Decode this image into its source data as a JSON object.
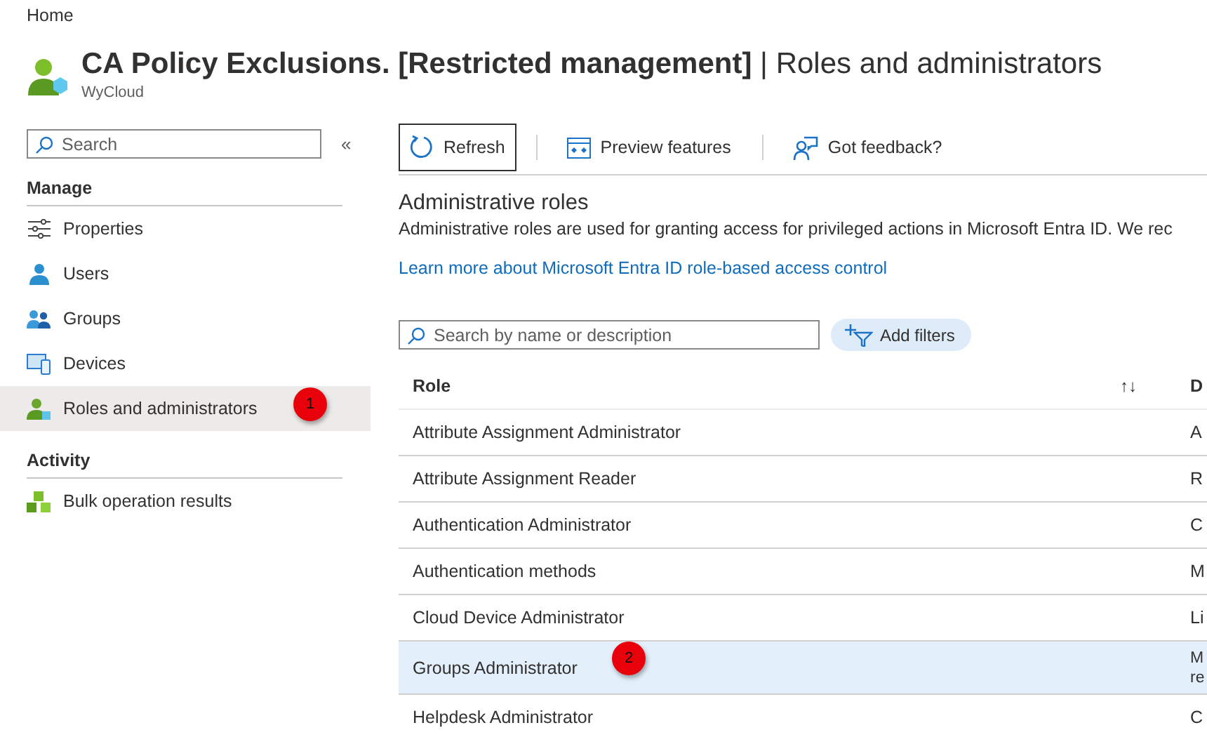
{
  "breadcrumb": "Home",
  "header": {
    "title_bold": "CA Policy Exclusions. [Restricted management]",
    "title_rest": "| Roles and administrators",
    "subtitle": "WyCloud"
  },
  "sidebar": {
    "search_placeholder": "Search",
    "collapse": "«",
    "sections": [
      {
        "heading": "Manage",
        "items": [
          {
            "label": "Properties",
            "kind": "sliders",
            "selected": false
          },
          {
            "label": "Users",
            "kind": "user",
            "selected": false
          },
          {
            "label": "Groups",
            "kind": "group",
            "selected": false
          },
          {
            "label": "Devices",
            "kind": "devices",
            "selected": false
          },
          {
            "label": "Roles and administrators",
            "kind": "role",
            "selected": true,
            "badge": "1"
          }
        ]
      },
      {
        "heading": "Activity",
        "items": [
          {
            "label": "Bulk operation results",
            "kind": "cubes",
            "selected": false
          }
        ]
      }
    ]
  },
  "toolbar": [
    {
      "label": "Refresh",
      "kind": "refresh",
      "focused": true
    },
    {
      "label": "Preview features",
      "kind": "preview",
      "focused": false
    },
    {
      "label": "Got feedback?",
      "kind": "feedback",
      "focused": false
    }
  ],
  "section": {
    "title": "Administrative roles",
    "description": "Administrative roles are used for granting access for privileged actions in Microsoft Entra ID. We rec",
    "link": "Learn more about Microsoft Entra ID role-based access control"
  },
  "filter": {
    "placeholder": "Search by name or description",
    "add_filters": "Add filters"
  },
  "table": {
    "columns": [
      {
        "label": "Role",
        "sort": "↑↓"
      },
      {
        "label": "D"
      }
    ],
    "rows": [
      {
        "role": "Attribute Assignment Administrator",
        "desc": "A",
        "selected": false
      },
      {
        "role": "Attribute Assignment Reader",
        "desc": "R",
        "selected": false
      },
      {
        "role": "Authentication Administrator",
        "desc": "C",
        "selected": false
      },
      {
        "role": "Authentication methods",
        "desc": "M",
        "selected": false
      },
      {
        "role": "Cloud Device Administrator",
        "desc": "Li",
        "selected": false
      },
      {
        "role": "Groups Administrator",
        "desc": "M re",
        "selected": true,
        "badge": "2"
      },
      {
        "role": "Helpdesk Administrator",
        "desc": "C",
        "selected": false
      }
    ]
  }
}
